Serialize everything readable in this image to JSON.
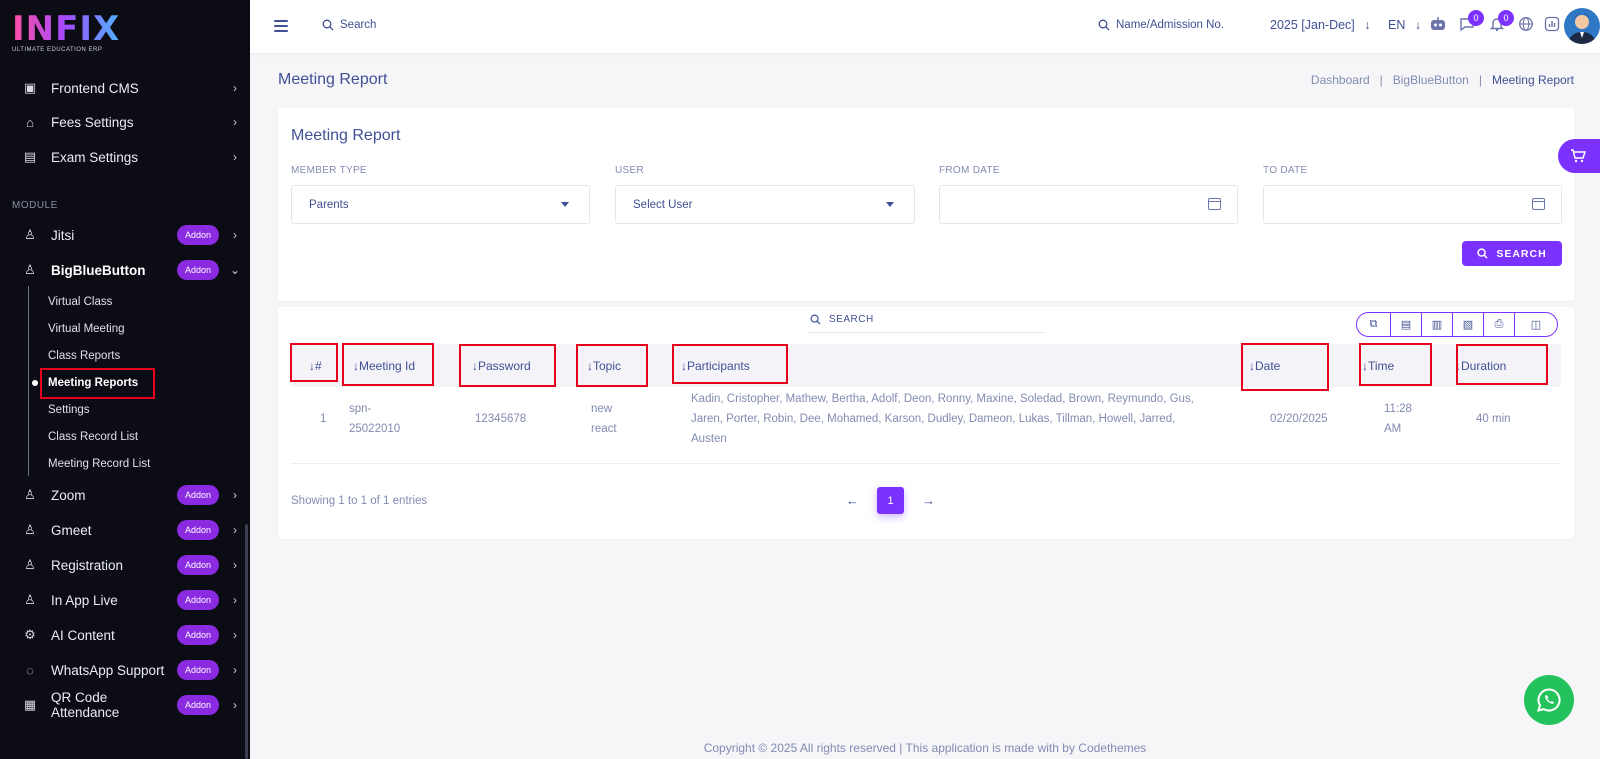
{
  "brand": {
    "logo": "INFIX",
    "tagline": "ULTIMATE EDUCATION ERP"
  },
  "sidebar": {
    "top_items": [
      {
        "label": "Frontend CMS",
        "icon": "monitor-icon"
      },
      {
        "label": "Fees Settings",
        "icon": "bank-icon"
      },
      {
        "label": "Exam Settings",
        "icon": "book-icon"
      }
    ],
    "section_label": "MODULE",
    "addon_label": "Addon",
    "modules": [
      {
        "label": "Jitsi"
      },
      {
        "label": "BigBlueButton"
      },
      {
        "label": "Zoom"
      },
      {
        "label": "Gmeet"
      },
      {
        "label": "Registration"
      },
      {
        "label": "In App Live"
      },
      {
        "label": "AI Content"
      },
      {
        "label": "WhatsApp Support"
      },
      {
        "label": "QR Code Attendance"
      }
    ],
    "submenu": [
      "Virtual Class",
      "Virtual Meeting",
      "Class Reports",
      "Meeting Reports",
      "Settings",
      "Class Record List",
      "Meeting Record List"
    ]
  },
  "topbar": {
    "search_placeholder": "Search",
    "student_search": "Name/Admission No.",
    "session": "2025 [Jan-Dec]",
    "language": "EN",
    "chat_badge": "0",
    "notification_badge": "0"
  },
  "page": {
    "title": "Meeting Report",
    "breadcrumb": [
      "Dashboard",
      "BigBlueButton",
      "Meeting Report"
    ]
  },
  "filter": {
    "title": "Meeting Report",
    "member_type_label": "MEMBER TYPE",
    "member_type_value": "Parents",
    "user_label": "USER",
    "user_value": "Select User",
    "from_date_label": "FROM DATE",
    "to_date_label": "TO DATE",
    "search_button": "SEARCH"
  },
  "table": {
    "search_placeholder": "SEARCH",
    "columns": [
      "#",
      "Meeting Id",
      "Password",
      "Topic",
      "Participants",
      "Date",
      "Time",
      "Duration"
    ],
    "rows": [
      {
        "index": "1",
        "meeting_id_1": "spn-",
        "meeting_id_2": "25022010",
        "password": "12345678",
        "topic_1": "new",
        "topic_2": "react",
        "participants_1": "Kadin, Cristopher, Mathew, Bertha, Adolf, Deon, Ronny, Maxine, Soledad, Brown, Reymundo, Gus,",
        "participants_2": "Jaren, Porter, Robin, Dee, Mohamed, Karson, Dudley, Dameon, Lukas, Tillman, Howell, Jarred,",
        "participants_3": "Austen",
        "date": "02/20/2025",
        "time_1": "11:28",
        "time_2": "AM",
        "duration": "40 min"
      }
    ],
    "entries_text": "Showing 1 to 1 of 1 entries",
    "current_page": "1"
  },
  "footer": "Copyright © 2025 All rights reserved | This application is made with by Codethemes",
  "colors": {
    "accent": "#7c32ff",
    "sidebar_bg": "#0b0c14",
    "highlight": "#e8001c",
    "whatsapp": "#24c25c"
  }
}
